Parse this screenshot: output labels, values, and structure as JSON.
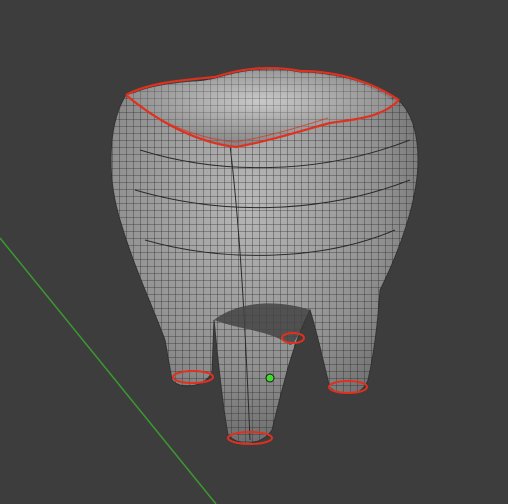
{
  "viewport": {
    "background_color": "#3d3d3d",
    "axis_color": "#3a9a2e",
    "seam_color": "#e0301e",
    "mesh_color": "#8f8f8f",
    "wire_color": "#2a2a2a",
    "pivot_color": "#3ddc2e"
  },
  "scene": {
    "object": "tooth-mesh",
    "mode": "edit-mode-wireframe",
    "seam_loops": [
      "crown-rim",
      "root-tip-left",
      "root-tip-back",
      "root-tip-front",
      "root-tip-right"
    ],
    "icons": [
      "origin-pivot-icon"
    ]
  }
}
